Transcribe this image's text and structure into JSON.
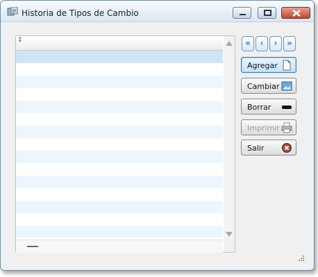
{
  "window": {
    "title": "Historia de Tipos de Cambio"
  },
  "grid": {
    "sort_glyph": "↕",
    "rows": 16,
    "selected_row": 1
  },
  "nav": {
    "first": "«",
    "prev": "‹",
    "next": "›",
    "last": "»"
  },
  "buttons": {
    "add": "Agregar",
    "change": "Cambiar",
    "delete": "Borrar",
    "print": "Imprimir",
    "exit": "Salir"
  },
  "colors": {
    "accent": "#3c7fb1",
    "row_alt": "#eef6fd",
    "row_selected": "#cfe5f7"
  }
}
